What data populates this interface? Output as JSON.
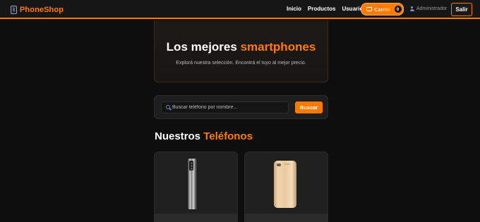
{
  "brand": {
    "name": "PhoneShop",
    "icon": "phone-icon",
    "color": "#ff7a00"
  },
  "nav": {
    "links": [
      "Inicio",
      "Productos",
      "Usuarios"
    ],
    "cart": {
      "label": "Carrito",
      "count": "0",
      "icon": "cart-icon"
    },
    "user": {
      "name": "Administrador",
      "icon": "user-icon"
    },
    "logout": "Salir"
  },
  "hero": {
    "title_prefix": "Los mejores",
    "title_accent": "smartphones",
    "subtitle": "Explorá nuestra selección. Encontrá el tuyo al mejor precio."
  },
  "search": {
    "placeholder": "Buscar teléfono por nombre...",
    "value": "",
    "button": "Buscar",
    "icon": "search-icon"
  },
  "section": {
    "title_prefix": "Nuestros",
    "title_accent": "Teléfonos"
  },
  "products": [
    {
      "image": "phone-dark-silver"
    },
    {
      "image": "phone-gold"
    }
  ],
  "colors": {
    "accent": "#ff7a00",
    "background": "#0e0e0e",
    "navbar": "#161616",
    "card": "#202020"
  }
}
